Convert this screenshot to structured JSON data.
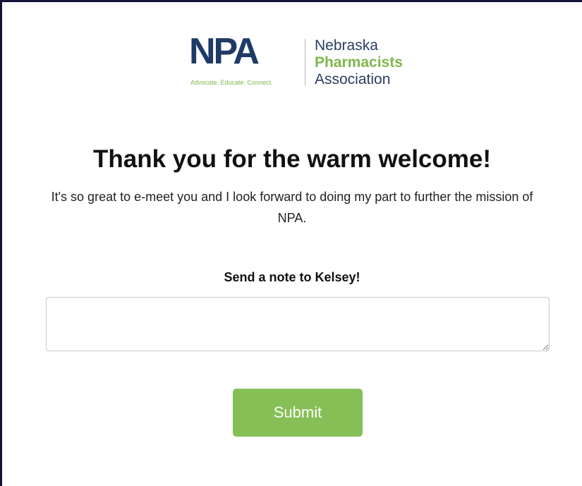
{
  "logo": {
    "letters": "NPA",
    "tagline": "Advocate. Educate. Connect.",
    "name_line1": "Nebraska",
    "name_line2": "Pharmacists",
    "name_line3": "Association"
  },
  "main": {
    "heading": "Thank you for the warm welcome!",
    "subtext": "It's so great to e-meet you and I look forward to doing my part to further the mission of NPA.",
    "note_label": "Send a note to Kelsey!",
    "note_value": "",
    "submit_label": "Submit"
  },
  "colors": {
    "brand_navy": "#1f3a66",
    "brand_green": "#7fb74b",
    "button_green": "#86bf55"
  }
}
